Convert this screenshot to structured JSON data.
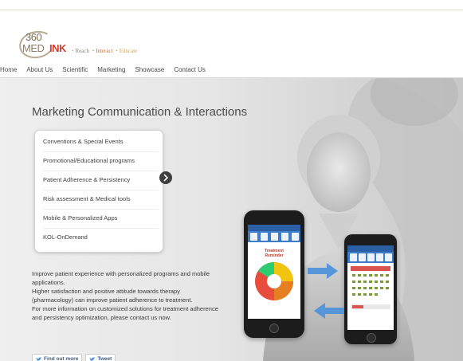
{
  "brand": {
    "logo_top": "360",
    "logo_med": "MED",
    "logo_ink": "INK",
    "tagline": [
      "Reach",
      "Interact",
      "Educate"
    ]
  },
  "nav": [
    "Home",
    "About Us",
    "Scientific",
    "Marketing",
    "Showcase",
    "Contact Us"
  ],
  "hero": {
    "title": "Marketing Communication & Interactions",
    "menu": [
      "Conventions & Special Events",
      "Promotional/Educational programs",
      "Patient Adherence & Persistency",
      "Risk assessment & Medical tools",
      "Mobile & Personalized Apps",
      "KOL-OnDemand"
    ],
    "description": [
      "Improve patient experience with personalized programs and mobile applications.",
      "Higher satisfaction and positive attitude towards therapy (pharmacology) can improve patient adherence to treatment.",
      "For more information on customized solutions for treatment adherence and persistency optimization, please contact us now."
    ],
    "buttons": {
      "find_out_more": "Find out more",
      "tweet": "Tweet"
    },
    "phone_screen": {
      "reminder": "Treatment Reminder"
    }
  },
  "colors": {
    "brand_red": "#c9412f",
    "nav_text": "#4a4a4a",
    "app_blue": "#2b5fa5",
    "arrow_blue": "#4a90d9"
  },
  "icons": [
    "arrow-right-icon",
    "twitter-bird-icon"
  ]
}
